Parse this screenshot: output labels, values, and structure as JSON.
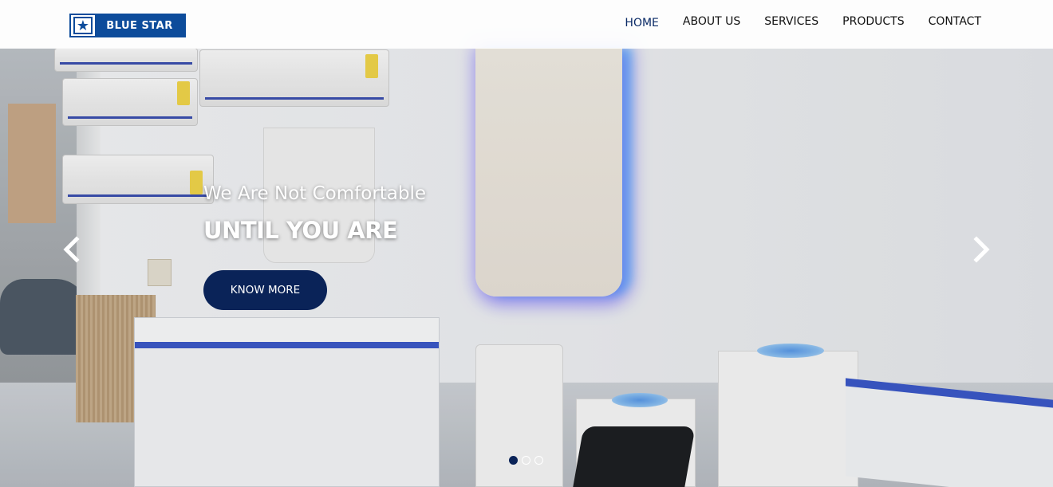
{
  "brand": {
    "logo_text": "BLUE STAR",
    "logo_icon": "star-icon",
    "color": "#0d4c9b"
  },
  "nav": {
    "items": [
      {
        "label": "HOME",
        "active": true
      },
      {
        "label": "ABOUT US",
        "active": false
      },
      {
        "label": "SERVICES",
        "active": false
      },
      {
        "label": "PRODUCTS",
        "active": false
      },
      {
        "label": "CONTACT",
        "active": false
      }
    ]
  },
  "hero": {
    "tagline": "We Are Not Comfortable",
    "headline": "UNTIL YOU ARE",
    "cta_label": "KNOW MORE",
    "cta_color": "#0a2358",
    "prev_icon": "chevron-left-icon",
    "next_icon": "chevron-right-icon"
  },
  "carousel": {
    "slide_count": 3,
    "active_index": 0
  }
}
